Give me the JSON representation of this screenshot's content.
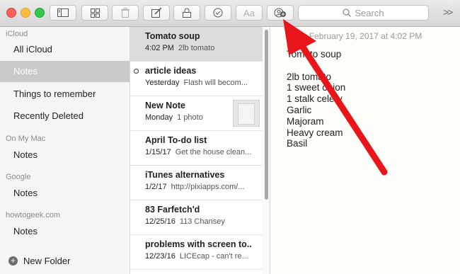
{
  "toolbar": {
    "traffic_lights": {
      "close": "#fc605c",
      "minimize": "#fdbc40",
      "zoom": "#34c84a"
    },
    "buttons": [
      {
        "name": "sidebar-toggle-button",
        "icon": "sidebar-icon"
      },
      {
        "name": "attachments-browser-button",
        "icon": "grid-icon"
      },
      {
        "name": "delete-button",
        "icon": "trash-icon"
      },
      {
        "name": "new-note-button",
        "icon": "compose-icon"
      },
      {
        "name": "lock-button",
        "icon": "lock-icon"
      },
      {
        "name": "checklist-button",
        "icon": "checkmark-circle-icon"
      },
      {
        "name": "format-button",
        "label": "Aa"
      },
      {
        "name": "add-people-button",
        "icon": "add-people-icon"
      }
    ],
    "search": {
      "placeholder": "Search"
    },
    "overflow_label": ">>"
  },
  "sidebar": {
    "sections": [
      {
        "heading": "iCloud",
        "items": [
          "All iCloud",
          "Notes",
          "Things to remember",
          "Recently Deleted"
        ],
        "selected": "Notes"
      },
      {
        "heading": "On My Mac",
        "items": [
          "Notes"
        ]
      },
      {
        "heading": "Google",
        "items": [
          "Notes"
        ]
      },
      {
        "heading": "howtogeek.com",
        "items": [
          "Notes"
        ]
      }
    ],
    "new_folder": "New Folder"
  },
  "notes": [
    {
      "title": "Tomato soup",
      "date": "4:02 PM",
      "preview": "2lb tomato",
      "selected": true
    },
    {
      "title": "article ideas",
      "date": "Yesterday",
      "preview": "Flash will becom...",
      "locked": true
    },
    {
      "title": "New Note",
      "date": "Monday",
      "preview": "1 photo",
      "thumbnail": true
    },
    {
      "title": "April To-do list",
      "date": "1/15/17",
      "preview": "Get the house clean..."
    },
    {
      "title": "iTunes alternatives",
      "date": "1/2/17",
      "preview": "http://pixiapps.com/..."
    },
    {
      "title": "83 Farfetch'd",
      "date": "12/25/16",
      "preview": "113 Chansey"
    },
    {
      "title": "problems with screen to...",
      "date": "12/23/16",
      "preview": "LICEcap - can't re..."
    }
  ],
  "editor": {
    "date_line": "February 19, 2017 at 4:02 PM",
    "lines": [
      "Tomato soup",
      "",
      "2lb tomato",
      "1 sweet onion",
      "1 stalk celery",
      "Garlic",
      "Majoram",
      "Heavy cream",
      "Basil"
    ]
  },
  "annotation": {
    "arrow_color": "#e8161b"
  }
}
